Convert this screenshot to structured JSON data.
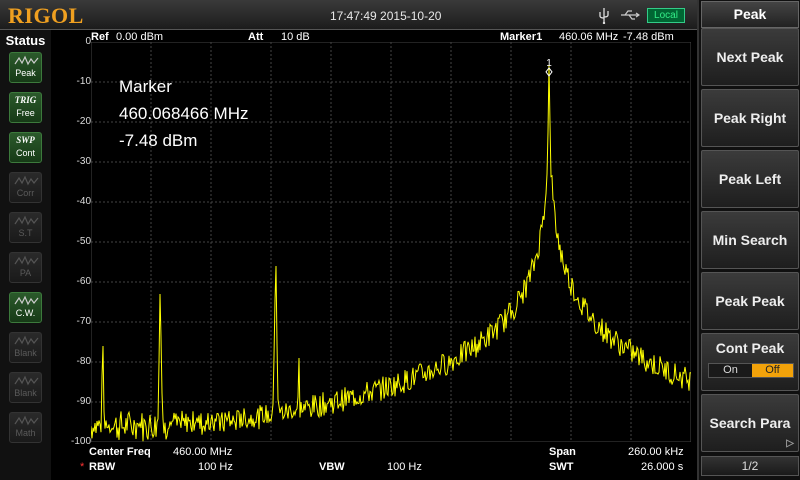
{
  "header": {
    "brand": "RIGOL",
    "datetime": "17:47:49 2015-10-20",
    "remote_status": "Local",
    "icons": [
      "usb-icon",
      "network-icon"
    ]
  },
  "status_panel": {
    "title": "Status",
    "items": [
      {
        "top": "",
        "label": "Peak",
        "icon": "peak-wave-icon",
        "active": true
      },
      {
        "top": "TRIG",
        "label": "Free",
        "icon": "",
        "active": true
      },
      {
        "top": "SWP",
        "label": "Cont",
        "icon": "",
        "active": true
      },
      {
        "top": "",
        "label": "Corr",
        "icon": "correction-icon",
        "active": false
      },
      {
        "top": "",
        "label": "S.T",
        "icon": "wave-icon",
        "active": false
      },
      {
        "top": "",
        "label": "PA",
        "icon": "preamp-icon",
        "active": false
      },
      {
        "top": "",
        "label": "C.W.",
        "icon": "cw-wave-icon",
        "active": true
      },
      {
        "top": "",
        "label": "Blank",
        "icon": "wave-icon",
        "active": false
      },
      {
        "top": "",
        "label": "Blank",
        "icon": "wave-icon",
        "active": false
      },
      {
        "top": "",
        "label": "Math",
        "icon": "wave-icon",
        "active": false
      }
    ]
  },
  "measurement": {
    "ref_label": "Ref",
    "ref_value": "0.00 dBm",
    "att_label": "Att",
    "att_value": "10 dB",
    "marker_label": "Marker1",
    "marker_freq": "460.06 MHz",
    "marker_amp": "-7.48 dBm",
    "marker_index": "1",
    "readout_title": "Marker",
    "readout_freq": "460.068466 MHz",
    "readout_amp": "-7.48 dBm",
    "center_freq_label": "Center Freq",
    "center_freq_value": "460.00 MHz",
    "span_label": "Span",
    "span_value": "260.00 kHz",
    "rbw_mark": "*",
    "rbw_label": "RBW",
    "rbw_value": "100 Hz",
    "vbw_label": "VBW",
    "vbw_value": "100 Hz",
    "swt_label": "SWT",
    "swt_value": "26.000 s"
  },
  "chart_data": {
    "type": "line",
    "title": "",
    "xlabel": "",
    "ylabel": "",
    "y_tick_labels": [
      "0",
      "-10",
      "-20",
      "-30",
      "-40",
      "-50",
      "-60",
      "-70",
      "-80",
      "-90",
      "-100"
    ],
    "ylim": [
      -100,
      0
    ],
    "xlim": [
      459.87,
      460.13
    ],
    "x_unit": "MHz",
    "y_unit": "dBm",
    "grid": true,
    "trace_color": "#ffff00",
    "noise_floor": -96,
    "peaks": [
      {
        "x": 459.875,
        "y": -76
      },
      {
        "x": 459.9,
        "y": -63
      },
      {
        "x": 459.95,
        "y": -56
      },
      {
        "x": 459.96,
        "y": -79
      },
      {
        "x": 460.0685,
        "y": -7.48
      }
    ],
    "marker": {
      "x": 460.068466,
      "y": -7.48
    }
  },
  "softkeys": {
    "menu_title": "Peak",
    "buttons": [
      "Next Peak",
      "Peak Right",
      "Peak Left",
      "Min Search",
      "Peak Peak",
      "Cont Peak",
      "Search Para"
    ],
    "cont_peak_on": "On",
    "cont_peak_off": "Off",
    "page": "1/2"
  },
  "colors": {
    "brand": "#f0a020",
    "trace": "#ffff00",
    "active_toggle": "#f2a20a",
    "local_badge": "#33ee88"
  }
}
